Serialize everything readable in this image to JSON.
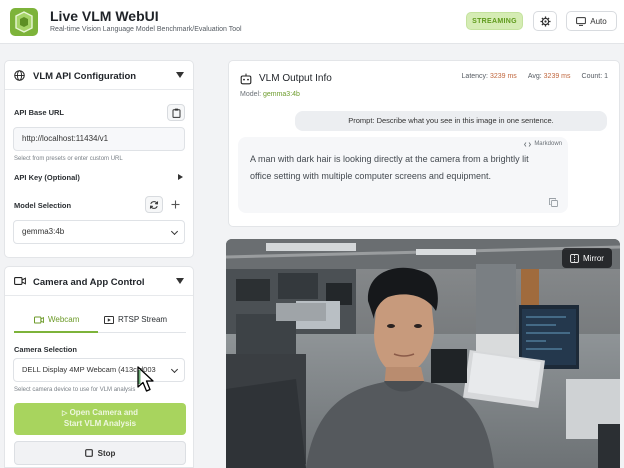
{
  "header": {
    "title": "Live VLM WebUI",
    "subtitle": "Real-time Vision Language Model Benchmark/Evaluation Tool",
    "status_badge": "STREAMING",
    "theme_button": "Auto"
  },
  "api_config": {
    "title": "VLM API Configuration",
    "base_url_label": "API Base URL",
    "base_url_value": "http://localhost:11434/v1",
    "base_url_hint": "Select from presets or enter custom URL",
    "api_key_label": "API Key (Optional)",
    "model_label": "Model Selection",
    "model_value": "gemma3:4b"
  },
  "camera_control": {
    "title": "Camera and App Control",
    "tabs": [
      {
        "label": "Webcam",
        "active": true
      },
      {
        "label": "RTSP Stream",
        "active": false
      }
    ],
    "camera_label": "Camera Selection",
    "camera_value": "DELL Display 4MP Webcam (413c:d003",
    "camera_hint": "Select camera device to use for VLM analysis",
    "start_button_line1": "Open Camera and",
    "start_button_line2": "Start VLM Analysis",
    "stop_button": "Stop"
  },
  "output": {
    "title": "VLM Output Info",
    "model_prefix": "Model:",
    "model_value": "gemma3:4b",
    "latency_label": "Latency:",
    "latency_value": "3239 ms",
    "avg_label": "Avg:",
    "avg_value": "3239 ms",
    "count_label": "Count:",
    "count_value": "1",
    "prompt": "Prompt: Describe what you see in this image in one sentence.",
    "format_badge": "Markdown",
    "response": "A man with dark hair is looking directly at the camera from a brightly lit office setting with multiple computer screens and equipment."
  },
  "video": {
    "mirror_button": "Mirror"
  },
  "colors": {
    "accent": "#7db33a",
    "badge_bg": "#d5ecb4",
    "primary_button": "#a8d45e",
    "metric_value": "#c0673e"
  }
}
